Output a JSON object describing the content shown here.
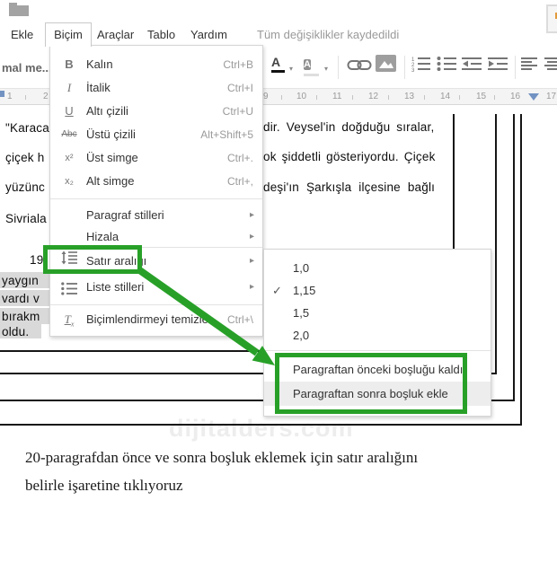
{
  "header": {
    "menus": [
      {
        "label": "Ekle"
      },
      {
        "label": "Biçim"
      },
      {
        "label": "Araçlar"
      },
      {
        "label": "Tablo"
      },
      {
        "label": "Yardım"
      }
    ],
    "save_status": "Tüm değişiklikler kaydedildi"
  },
  "toolbar": {
    "style_dropdown": "mal me...",
    "text_color_glyph": "A",
    "highlight_glyph": "A"
  },
  "ruler": {
    "numbers_left": [
      "1",
      "2"
    ],
    "numbers_right": [
      "9",
      "10",
      "11",
      "12",
      "13",
      "14",
      "15",
      "16",
      "17"
    ]
  },
  "format_menu": {
    "items": [
      {
        "label": "Kalın",
        "shortcut": "Ctrl+B",
        "icon": "B"
      },
      {
        "label": "İtalik",
        "shortcut": "Ctrl+I",
        "icon": "I"
      },
      {
        "label": "Altı çizili",
        "shortcut": "Ctrl+U",
        "icon": "U"
      },
      {
        "label": "Üstü çizili",
        "shortcut": "Alt+Shift+5",
        "icon": "Abc"
      },
      {
        "label": "Üst simge",
        "shortcut": "Ctrl+.",
        "icon": "x²"
      },
      {
        "label": "Alt simge",
        "shortcut": "Ctrl+,",
        "icon": "x₂"
      },
      {
        "label": "Paragraf stilleri"
      },
      {
        "label": "Hizala"
      },
      {
        "label": "Satır aralığı"
      },
      {
        "label": "Liste stilleri"
      },
      {
        "label": "Biçimlendirmeyi temizle",
        "shortcut": "Ctrl+\\",
        "icon": "Tx"
      }
    ]
  },
  "spacing_submenu": {
    "options": [
      {
        "label": "1,0",
        "checked": false
      },
      {
        "label": "1,15",
        "checked": true
      },
      {
        "label": "1,5",
        "checked": false
      },
      {
        "label": "2,0",
        "checked": false
      }
    ],
    "actions": [
      {
        "label": "Paragraftan önceki boşluğu kaldır"
      },
      {
        "label": "Paragraftan sonra boşluk ekle"
      }
    ]
  },
  "document": {
    "left_lines": [
      "\"Karaca",
      "çiçek h",
      "yüzünc",
      "Sivriala",
      "19"
    ],
    "selected_lines": [
      "yaygın",
      "vardı v",
      "bırakm",
      "oldu."
    ],
    "right_lines": [
      "dir. Veysel'in doğduğu sıralar,",
      "ok şiddetli gösteriyordu. Çiçek",
      "deşi'ın Şarkışla ilçesine bağlı"
    ]
  },
  "watermark": "dijitalders.com",
  "caption": {
    "line1": "20-paragrafdan önce ve sonra boşluk eklemek için satır aralığını",
    "line2": "belirle işaretine tıklıyoruz"
  },
  "glyphs": {
    "submenu_arrow": "▸",
    "check": "✓",
    "chevron": "▾"
  },
  "colors": {
    "annotation_green": "#28a028",
    "selection_gray": "#d9d9d9"
  }
}
